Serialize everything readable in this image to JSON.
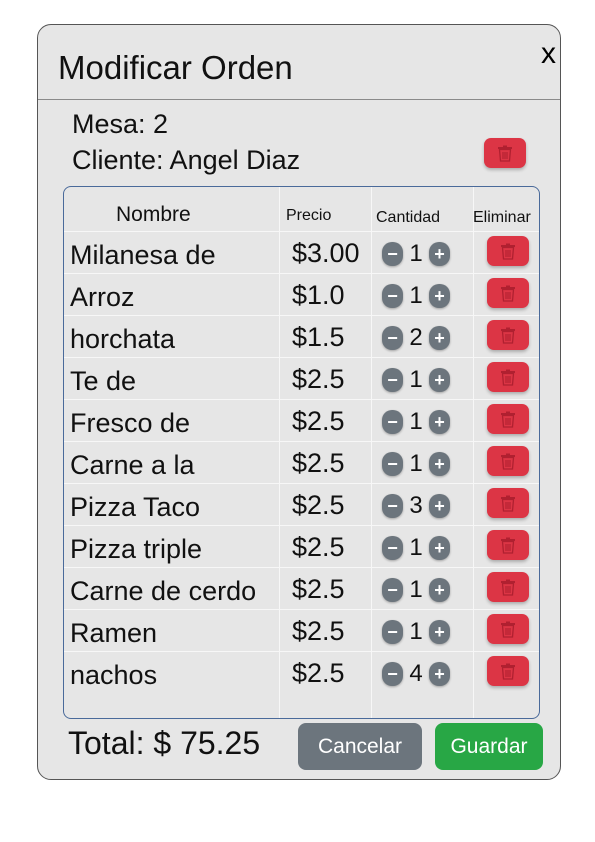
{
  "modal": {
    "title": "Modificar Orden",
    "close_label": "x"
  },
  "order": {
    "mesa_label": "Mesa: 2",
    "cliente_label": "Cliente: Angel Diaz",
    "delete_icon": "trash-icon"
  },
  "table": {
    "headers": {
      "nombre": "Nombre",
      "precio": "Precio",
      "cantidad": "Cantidad",
      "eliminar": "Eliminar"
    },
    "decrement_label": "−",
    "increment_label": "+",
    "rows": [
      {
        "name": "Milanesa de",
        "price": "$3.00",
        "qty": "1"
      },
      {
        "name": "Arroz",
        "price": "$1.0",
        "qty": "1"
      },
      {
        "name": "horchata",
        "price": "$1.5",
        "qty": "2"
      },
      {
        "name": "Te de",
        "price": "$2.5",
        "qty": "1"
      },
      {
        "name": "Fresco de",
        "price": "$2.5",
        "qty": "1"
      },
      {
        "name": "Carne a la",
        "price": "$2.5",
        "qty": "1"
      },
      {
        "name": "Pizza Taco",
        "price": "$2.5",
        "qty": "3"
      },
      {
        "name": "Pizza  triple",
        "price": "$2.5",
        "qty": "1"
      },
      {
        "name": "Carne de cerdo",
        "price": "$2.5",
        "qty": "1"
      },
      {
        "name": "Ramen",
        "price": "$2.5",
        "qty": "1"
      },
      {
        "name": "nachos",
        "price": "$2.5",
        "qty": "4"
      }
    ]
  },
  "footer": {
    "total_label": "Total:",
    "total_value": "$ 75.25",
    "cancel_label": "Cancelar",
    "save_label": "Guardar"
  },
  "colors": {
    "danger": "#dc3545",
    "secondary": "#6c757d",
    "success": "#28a745",
    "modal_bg": "#e6e6e6"
  }
}
